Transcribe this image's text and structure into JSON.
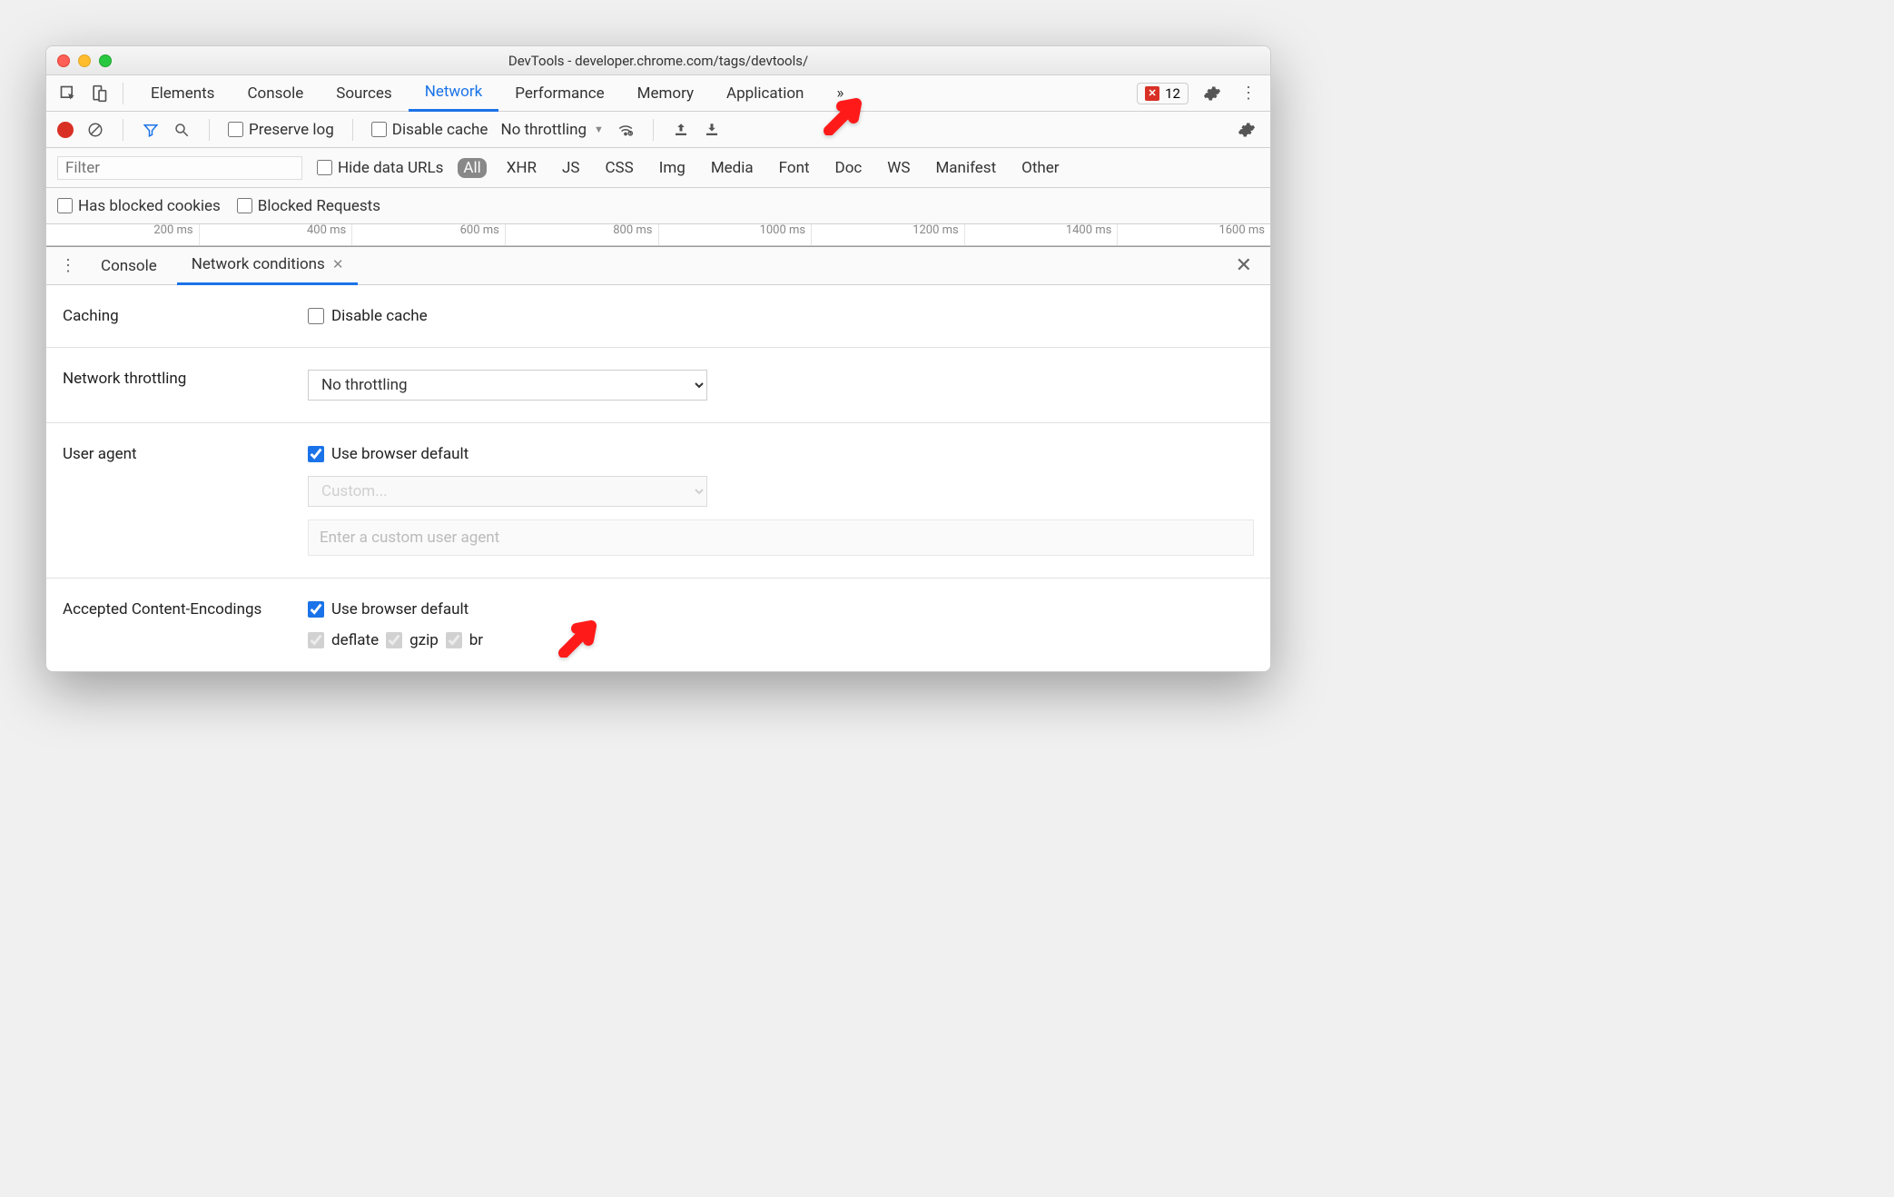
{
  "titlebar": {
    "title": "DevTools - developer.chrome.com/tags/devtools/"
  },
  "tabs": [
    "Elements",
    "Console",
    "Sources",
    "Network",
    "Performance",
    "Memory",
    "Application"
  ],
  "tabs_active": "Network",
  "tabs_overflow": "»",
  "error_count": "12",
  "toolbar": {
    "preserve_log": "Preserve log",
    "disable_cache": "Disable cache",
    "throttling": "No throttling"
  },
  "filterbar": {
    "filter_placeholder": "Filter",
    "hide_data_urls": "Hide data URLs",
    "chips": [
      "All",
      "XHR",
      "JS",
      "CSS",
      "Img",
      "Media",
      "Font",
      "Doc",
      "WS",
      "Manifest",
      "Other"
    ],
    "chips_active": "All"
  },
  "toolbar3": {
    "has_blocked": "Has blocked cookies",
    "blocked_req": "Blocked Requests"
  },
  "timeline_ticks": [
    "200 ms",
    "400 ms",
    "600 ms",
    "800 ms",
    "1000 ms",
    "1200 ms",
    "1400 ms",
    "1600 ms"
  ],
  "drawer": {
    "tabs": {
      "console": "Console",
      "netcond": "Network conditions"
    }
  },
  "sections": {
    "caching": {
      "label": "Caching",
      "disable_cache": "Disable cache"
    },
    "throttling": {
      "label": "Network throttling",
      "value": "No throttling"
    },
    "useragent": {
      "label": "User agent",
      "use_default": "Use browser default",
      "custom_select": "Custom...",
      "custom_placeholder": "Enter a custom user agent"
    },
    "encodings": {
      "label": "Accepted Content-Encodings",
      "use_default": "Use browser default",
      "opts": [
        "deflate",
        "gzip",
        "br"
      ]
    }
  }
}
